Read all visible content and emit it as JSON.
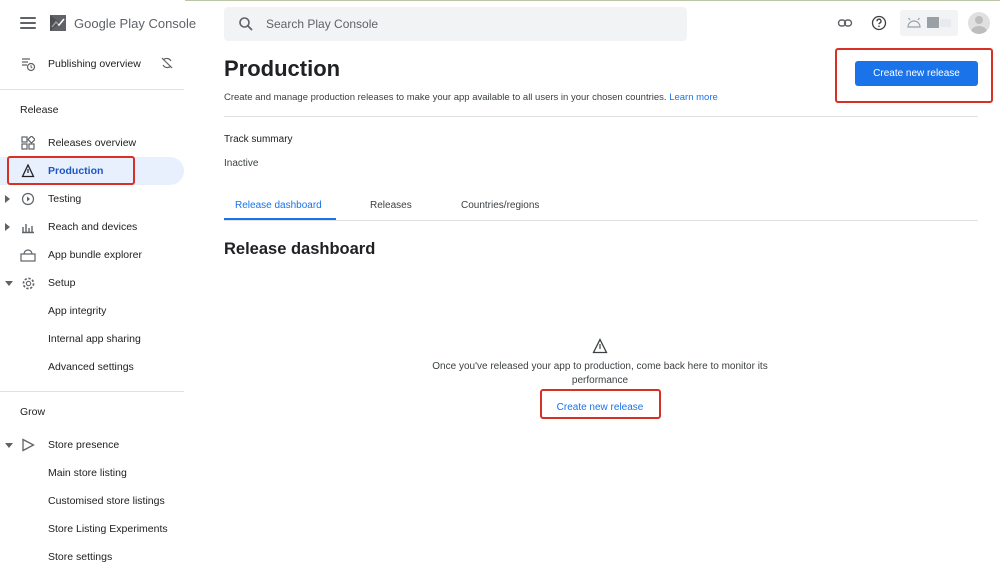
{
  "app": {
    "brand_part1": "Google Play",
    "brand_part2": "Console"
  },
  "search": {
    "placeholder": "Search Play Console"
  },
  "sidebar": {
    "publishing_overview": "Publishing overview",
    "release_section": "Release",
    "release_items": [
      {
        "label": "Releases overview"
      },
      {
        "label": "Production"
      },
      {
        "label": "Testing"
      },
      {
        "label": "Reach and devices"
      },
      {
        "label": "App bundle explorer"
      },
      {
        "label": "Setup"
      },
      {
        "label": "App integrity"
      },
      {
        "label": "Internal app sharing"
      },
      {
        "label": "Advanced settings"
      }
    ],
    "grow_section": "Grow",
    "grow_items": [
      {
        "label": "Store presence"
      },
      {
        "label": "Main store listing"
      },
      {
        "label": "Customised store listings"
      },
      {
        "label": "Store Listing Experiments"
      },
      {
        "label": "Store settings"
      }
    ]
  },
  "main": {
    "title": "Production",
    "description": "Create and manage production releases to make your app available to all users in your chosen countries.",
    "learn_more": "Learn more",
    "create_button": "Create new release",
    "track_summary_label": "Track summary",
    "track_status": "Inactive",
    "tabs": [
      {
        "label": "Release dashboard"
      },
      {
        "label": "Releases"
      },
      {
        "label": "Countries/regions"
      }
    ],
    "section_title": "Release dashboard",
    "empty_message": "Once you've released your app to production, come back here to monitor its performance",
    "empty_create_button": "Create new release"
  },
  "colors": {
    "accent": "#1a73e8",
    "highlight": "#d93025",
    "active_bg": "#e8f0fe"
  }
}
